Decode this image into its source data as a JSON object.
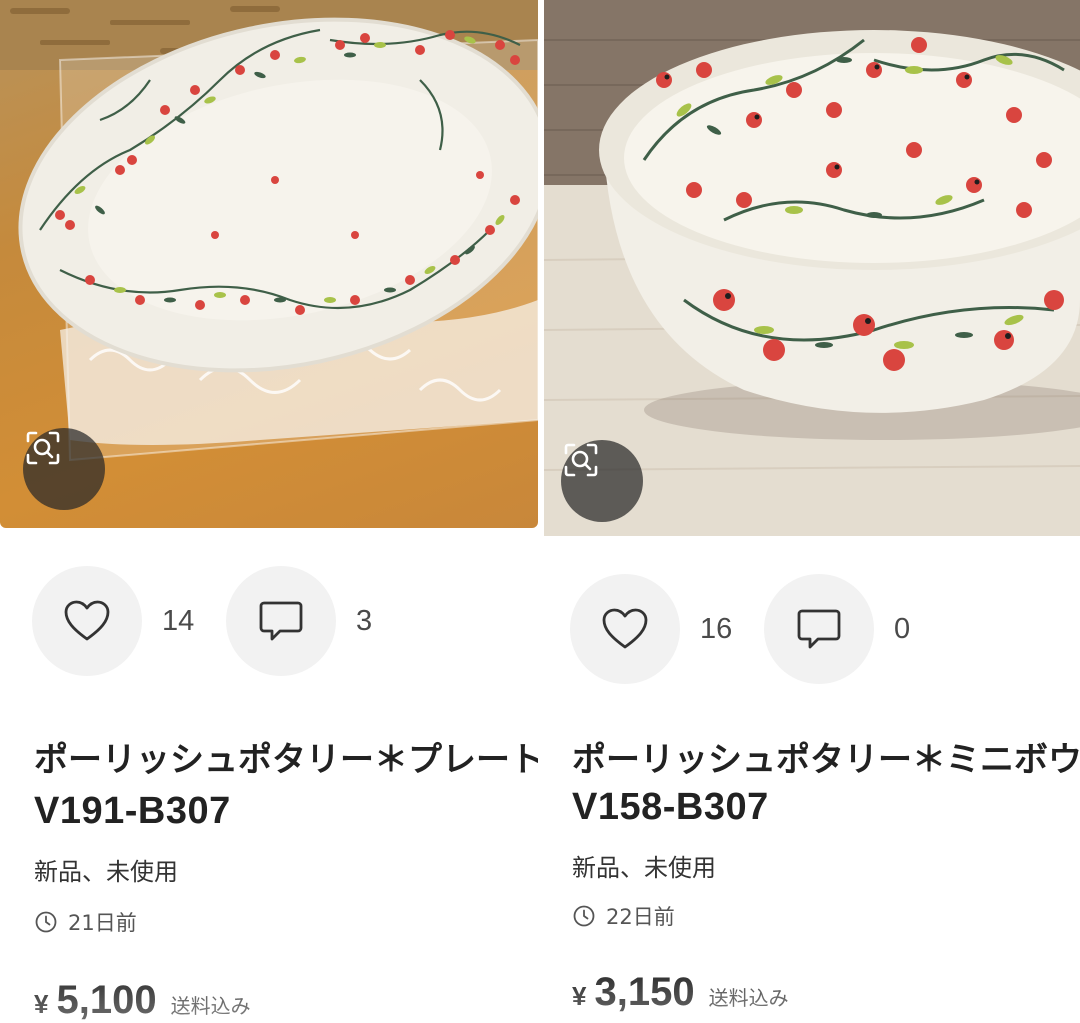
{
  "items": [
    {
      "likes": "14",
      "comments": "3",
      "title": "ポーリッシュポタリー＊プレート",
      "sku": "V191-B307",
      "condition": "新品、未使用",
      "posted": "21日前",
      "currency": "¥",
      "price": "5,100",
      "shipping": "送料込み"
    },
    {
      "likes": "16",
      "comments": "0",
      "title": "ポーリッシュポタリー＊ミニボウル",
      "sku": "V158-B307",
      "condition": "新品、未使用",
      "posted": "22日前",
      "currency": "¥",
      "price": "3,150",
      "shipping": "送料込み"
    }
  ],
  "icons": {
    "lens": "image-search-icon",
    "like": "heart-icon",
    "comment": "comment-icon",
    "time": "clock-icon"
  },
  "colors": {
    "berry": "#d9453f",
    "leaf_dark": "#3f5f48",
    "leaf_light": "#a8c24a",
    "ceramic": "#f4f1e8"
  }
}
